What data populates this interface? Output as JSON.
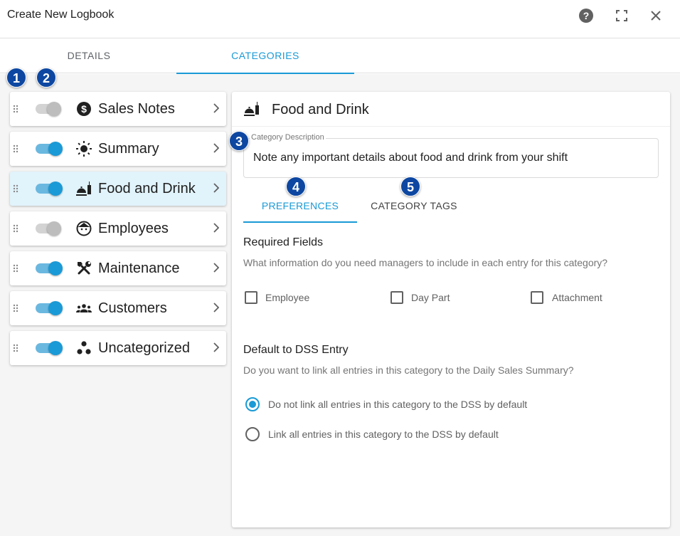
{
  "app": {
    "title": "Create New Logbook"
  },
  "header_icons": [
    "help-icon",
    "fullscreen-icon",
    "close-icon"
  ],
  "tabs": [
    {
      "label": "DETAILS"
    },
    {
      "label": "CATEGORIES",
      "active": true
    }
  ],
  "badges": [
    "1",
    "2",
    "3",
    "4",
    "5"
  ],
  "categories": [
    {
      "label": "Sales Notes",
      "enabled": false,
      "icon": "dollar-circle-icon"
    },
    {
      "label": "Summary",
      "enabled": true,
      "icon": "sun-icon"
    },
    {
      "label": "Food and Drink",
      "enabled": true,
      "icon": "food-drink-icon",
      "selected": true
    },
    {
      "label": "Employees",
      "enabled": false,
      "icon": "face-icon"
    },
    {
      "label": "Maintenance",
      "enabled": true,
      "icon": "tools-icon"
    },
    {
      "label": "Customers",
      "enabled": true,
      "icon": "people-icon"
    },
    {
      "label": "Uncategorized",
      "enabled": true,
      "icon": "dots-icon"
    }
  ],
  "detail": {
    "title": "Food and Drink",
    "description_label": "Category Description",
    "description_value": "Note any important details about food and drink from your shift",
    "subtabs": [
      {
        "label": "PREFERENCES",
        "active": true
      },
      {
        "label": "CATEGORY TAGS"
      }
    ],
    "required": {
      "title": "Required Fields",
      "subtitle": "What information do you need managers to include in each entry for this category?",
      "options": [
        "Employee",
        "Day Part",
        "Attachment"
      ]
    },
    "dss": {
      "title": "Default to DSS Entry",
      "subtitle": "Do you want to link all entries in this category to the Daily Sales Summary?",
      "options": [
        {
          "label": "Do not link all entries in this category to the DSS by default",
          "checked": true
        },
        {
          "label": "Link all entries in this category to the DSS by default",
          "checked": false
        }
      ]
    }
  },
  "colors": {
    "accent": "#1a9ad6",
    "badge": "#0d47a1",
    "selected_bg": "#e1f3fb"
  }
}
